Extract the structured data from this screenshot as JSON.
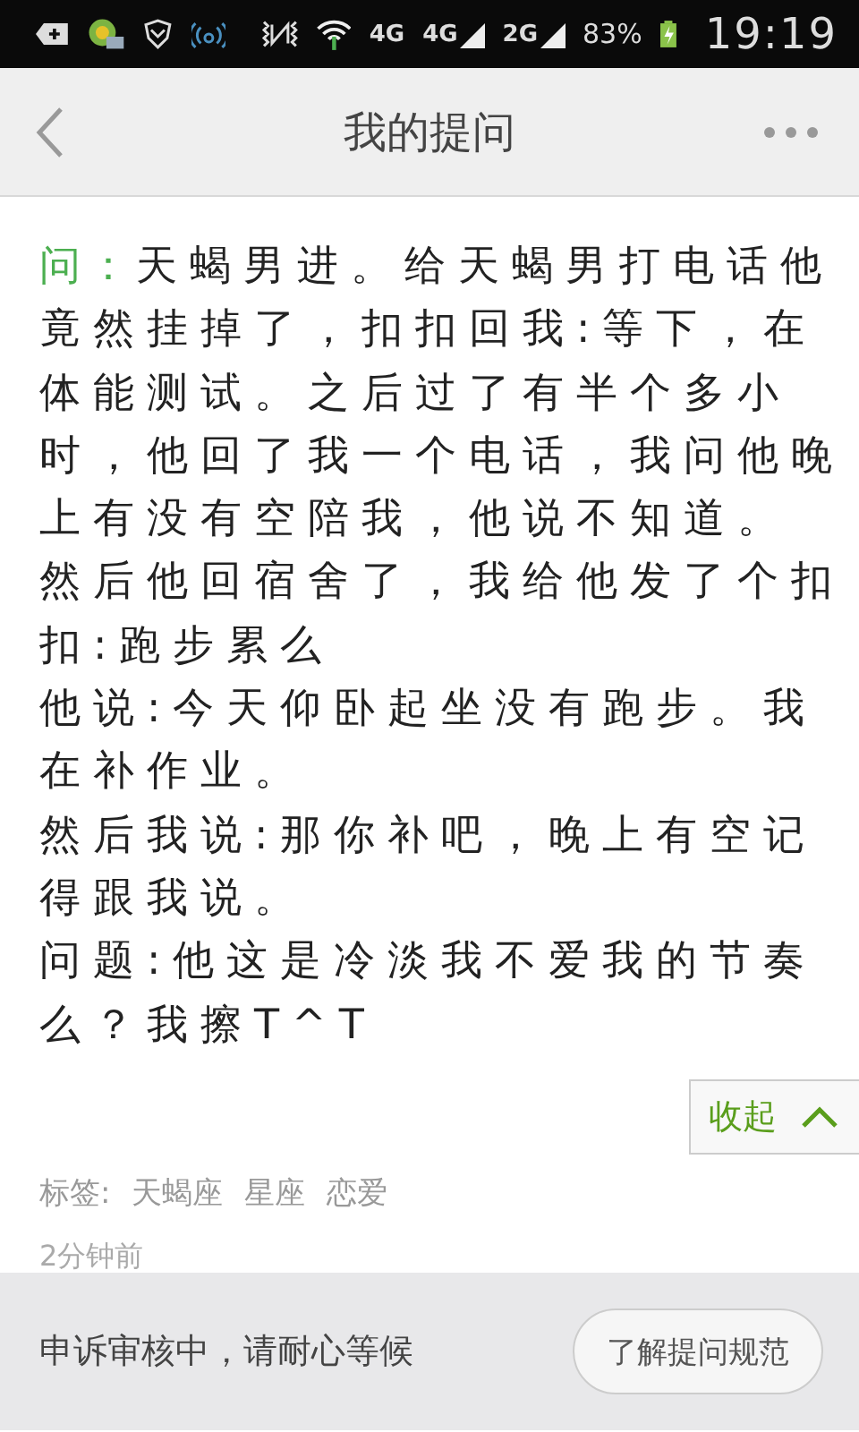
{
  "status_bar": {
    "network_labels": [
      {
        "label": "4G",
        "kind": "plain"
      },
      {
        "label": "4G",
        "kind": "bars"
      },
      {
        "label": "2G",
        "kind": "bars"
      }
    ],
    "battery": "83%",
    "time": "19:19"
  },
  "nav": {
    "title": "我的提问"
  },
  "question": {
    "prefix": "问：",
    "paragraphs": [
      "天蝎男进。给天蝎男打电话他竟然挂掉了，扣扣回我:等下，在体能测试。之后过了有半个多小时，他回了我一个电话，我问他晚上有没有空陪我，他说不知道。",
      "然后他回宿舍了，我给他发了个扣扣:跑步累么",
      "他说:今天仰卧起坐没有跑步。我在补作业。",
      "然后我说:那你补吧，晚上有空记得跟我说。",
      "问题:他这是冷淡我不爱我的节奏么？我擦T^T"
    ],
    "collapse_label": "收起",
    "expanded": true,
    "tags_label": "标签:",
    "tags": [
      "天蝎座",
      "星座",
      "恋爱"
    ],
    "time": "2分钟前"
  },
  "footer": {
    "status": "申诉审核中，请耐心等候",
    "button": "了解提问规范"
  }
}
